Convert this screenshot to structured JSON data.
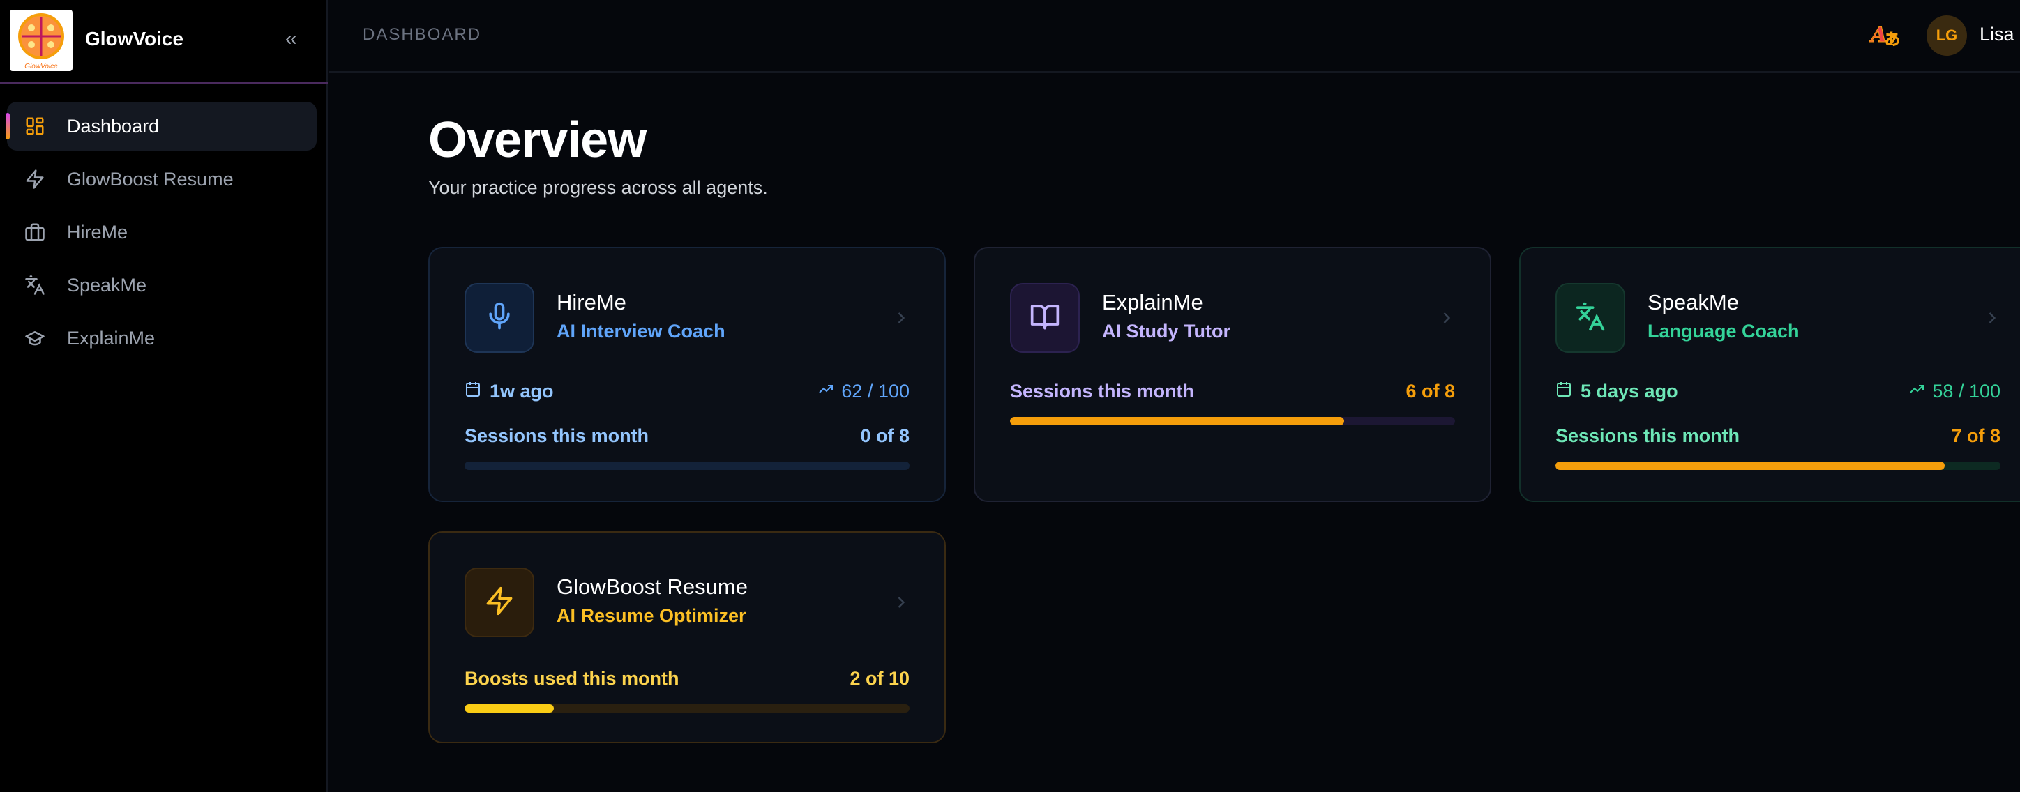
{
  "app": {
    "name": "GlowVoice",
    "logo_text": "GlowVoice"
  },
  "sidebar": {
    "items": [
      {
        "label": "Dashboard",
        "icon": "dashboard-grid-icon",
        "active": true
      },
      {
        "label": "GlowBoost Resume",
        "icon": "lightning-icon",
        "active": false
      },
      {
        "label": "HireMe",
        "icon": "briefcase-icon",
        "active": false
      },
      {
        "label": "SpeakMe",
        "icon": "translate-icon",
        "active": false
      },
      {
        "label": "ExplainMe",
        "icon": "graduation-cap-icon",
        "active": false
      }
    ]
  },
  "header": {
    "breadcrumb": "DASHBOARD",
    "user_initials": "LG",
    "user_name": "Lisa G"
  },
  "main": {
    "title": "Overview",
    "subtitle": "Your practice progress across all agents."
  },
  "cards": [
    {
      "title": "HireMe",
      "subtitle": "AI Interview Coach",
      "icon": "microphone-icon",
      "last_session": "1w ago",
      "score": "62 / 100",
      "progress_label": "Sessions this month",
      "progress_text": "0 of 8",
      "progress": 0.0,
      "accent": "#60a5fa",
      "label_color": "#93c5fd"
    },
    {
      "title": "ExplainMe",
      "subtitle": "AI Study Tutor",
      "icon": "open-book-icon",
      "progress_label": "Sessions this month",
      "progress_text": "6 of 8",
      "progress": 0.75,
      "accent": "#c4b5fd",
      "label_color": "#c4b5fd"
    },
    {
      "title": "SpeakMe",
      "subtitle": "Language Coach",
      "icon": "translate-icon",
      "last_session": "5 days ago",
      "score": "58 / 100",
      "progress_label": "Sessions this month",
      "progress_text": "7 of 8",
      "progress": 0.875,
      "accent": "#34d399",
      "label_color": "#6ee7b7"
    },
    {
      "title": "GlowBoost Resume",
      "subtitle": "AI Resume Optimizer",
      "icon": "lightning-icon",
      "progress_label": "Boosts used this month",
      "progress_text": "2 of 10",
      "progress": 0.2,
      "accent": "#fbbf24",
      "label_color": "#fcd34d"
    }
  ],
  "colors": {
    "progress_fill": "#f59e0b",
    "background": "#05070c"
  }
}
